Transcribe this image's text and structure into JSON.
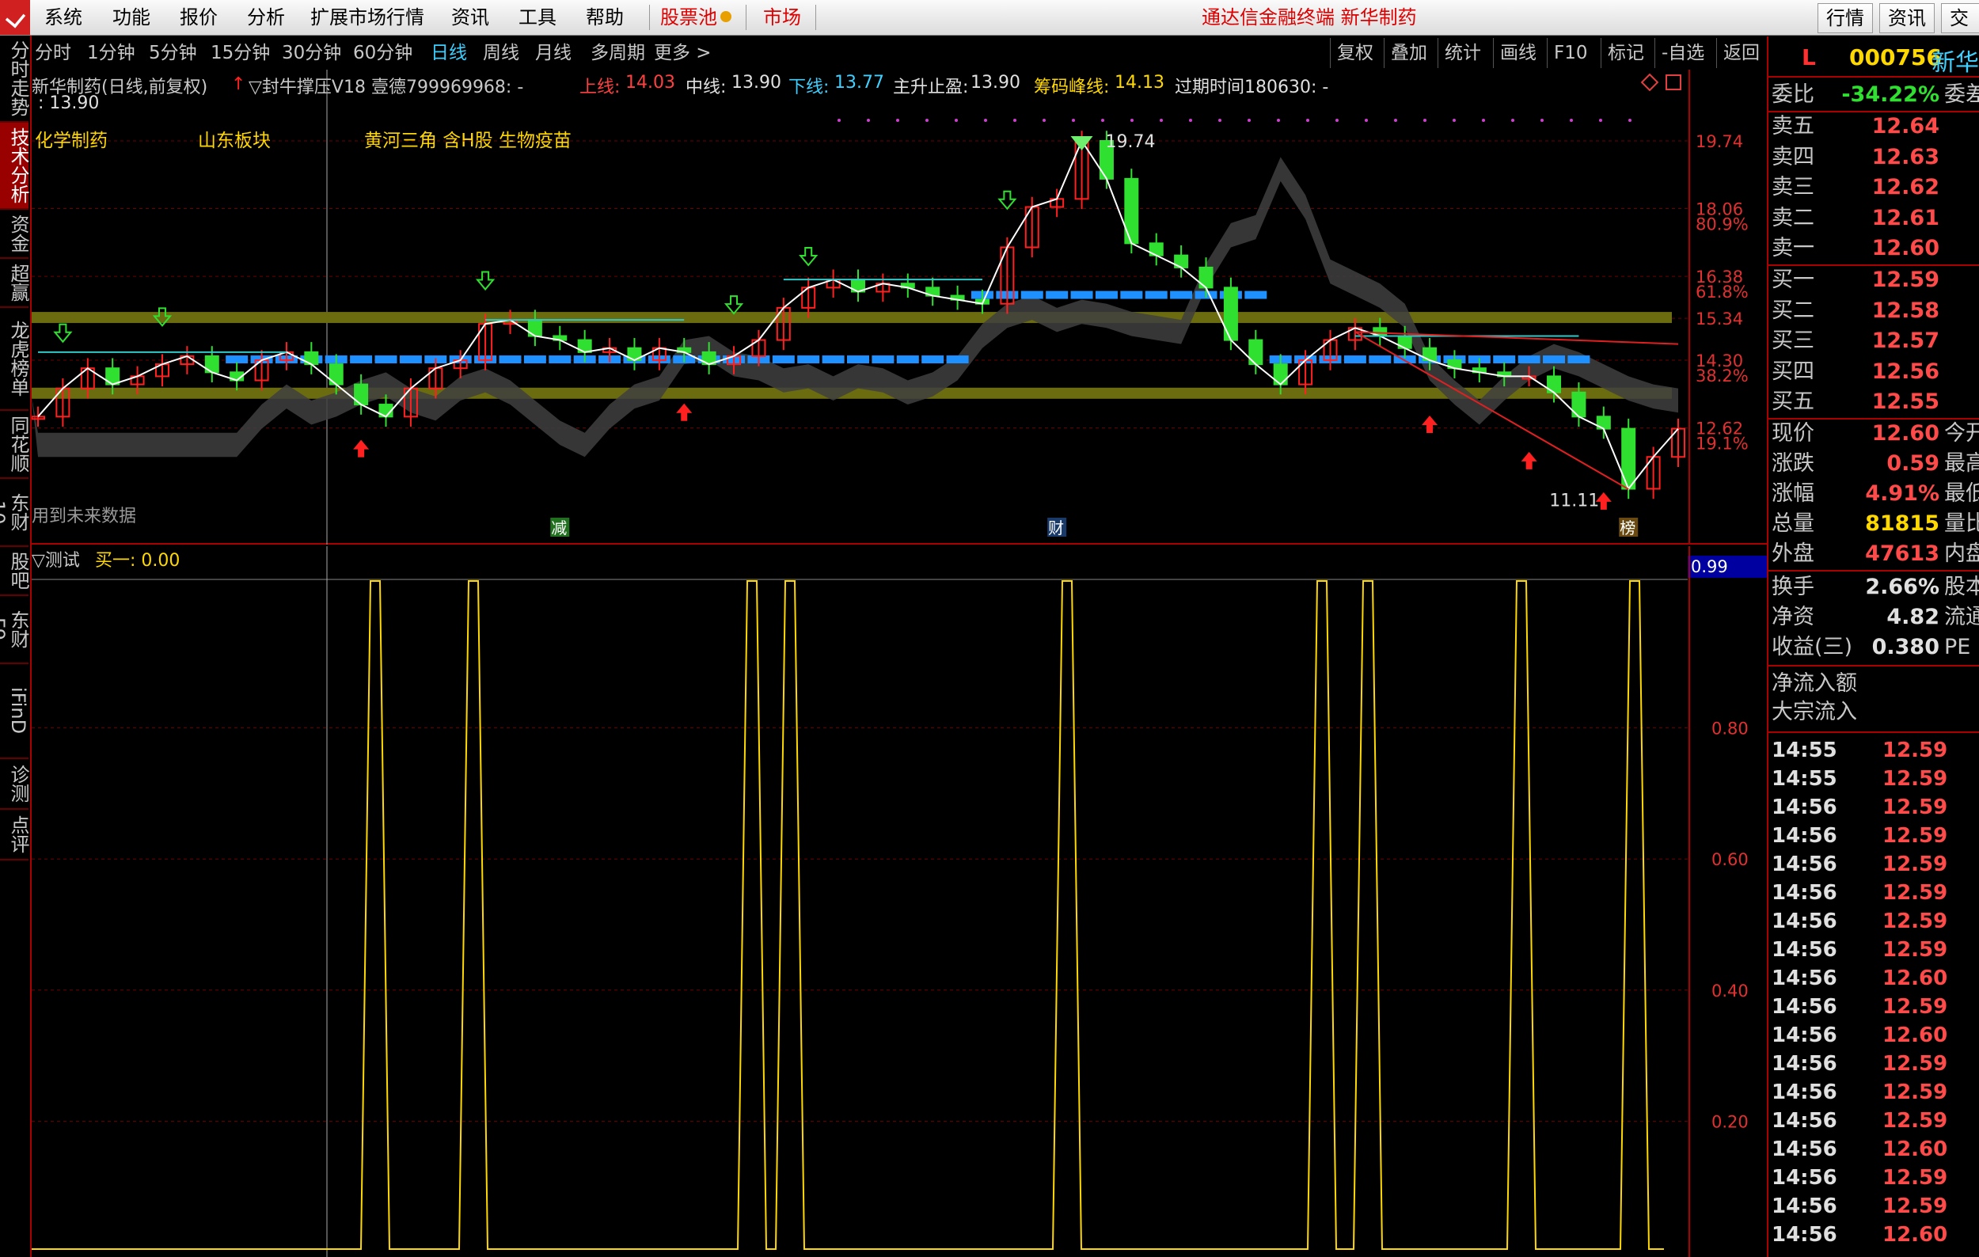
{
  "menubar": {
    "items": [
      "系统",
      "功能",
      "报价",
      "分析",
      "扩展市场行情",
      "资讯",
      "工具",
      "帮助"
    ],
    "stock_pool": "股票池",
    "market": "市场",
    "title": "通达信金融终端  新华制药",
    "right_buttons": [
      "行情",
      "资讯",
      "交易"
    ]
  },
  "lefttabs": [
    "分时走势",
    "技术分析",
    "资金",
    "超赢",
    "龙虎榜单",
    "同花顺",
    "东财10",
    "股吧",
    "东财F9",
    "iFinD",
    "诊测",
    "点评"
  ],
  "periodbar": {
    "periods": [
      "分时",
      "1分钟",
      "5分钟",
      "15分钟",
      "30分钟",
      "60分钟",
      "日线",
      "周线",
      "月线",
      "多周期",
      "更多 >"
    ],
    "active": "日线",
    "tools": [
      "复权",
      "叠加",
      "统计",
      "画线",
      "F10",
      "标记",
      "-自选",
      "返回"
    ]
  },
  "main_chart": {
    "header_name": "新华制药(日线,前复权)",
    "indicator_name": "▽封牛撑压V18 壹德799969968: -",
    "up_label": "上线:",
    "up_val": "14.03",
    "mid_label": "中线:",
    "mid_val": "13.90",
    "down_label": "下线:",
    "down_val": "13.77",
    "stop_label": "主升止盈:",
    "stop_val": "13.90",
    "peak_label": "筹码峰线:",
    "peak_val": "14.13",
    "expire_label": "过期时间180630: -",
    "second_line": ": 13.90",
    "tags": [
      "化学制药",
      "山东板块",
      "黄河三角 含H股 生物疫苗"
    ],
    "future_note": "用到未来数据",
    "high_mark": "19.74",
    "low_mark": "11.11",
    "markers": [
      "减",
      "财",
      "榜"
    ],
    "y_labels": [
      {
        "v": "19.74",
        "pct": ""
      },
      {
        "v": "18.06",
        "pct": "80.9%"
      },
      {
        "v": "16.38",
        "pct": "61.8%"
      },
      {
        "v": "15.34",
        "pct": ""
      },
      {
        "v": "14.30",
        "pct": "38.2%"
      },
      {
        "v": "12.62",
        "pct": "19.1%"
      }
    ]
  },
  "sub_chart": {
    "title": "▽测试",
    "series_label": "买一: 0.00",
    "current": "0.99",
    "y_labels": [
      "0.80",
      "0.60",
      "0.40",
      "0.20"
    ]
  },
  "quote": {
    "code_prefix": "L",
    "code": "000756",
    "name": "新华",
    "weibi_label": "委比",
    "weibi_val": "-34.22%",
    "weibi_extra": "委差",
    "asks": [
      {
        "label": "卖五",
        "price": "12.64"
      },
      {
        "label": "卖四",
        "price": "12.63"
      },
      {
        "label": "卖三",
        "price": "12.62"
      },
      {
        "label": "卖二",
        "price": "12.61"
      },
      {
        "label": "卖一",
        "price": "12.60"
      }
    ],
    "bids": [
      {
        "label": "买一",
        "price": "12.59"
      },
      {
        "label": "买二",
        "price": "12.58"
      },
      {
        "label": "买三",
        "price": "12.57"
      },
      {
        "label": "买四",
        "price": "12.56"
      },
      {
        "label": "买五",
        "price": "12.55"
      }
    ],
    "stats1": [
      {
        "label": "现价",
        "val": "12.60",
        "extra": "今开"
      },
      {
        "label": "涨跌",
        "val": "0.59",
        "extra": "最高"
      },
      {
        "label": "涨幅",
        "val": "4.91%",
        "extra": "最低"
      },
      {
        "label": "总量",
        "val": "81815",
        "extra": "量比"
      },
      {
        "label": "外盘",
        "val": "47613",
        "extra": "内盘"
      }
    ],
    "stats2": [
      {
        "label": "换手",
        "val": "2.66%",
        "extra": "股本"
      },
      {
        "label": "净资",
        "val": "4.82",
        "extra": "流通"
      },
      {
        "label": "收益(三)",
        "val": "0.380",
        "extra": "PE"
      }
    ],
    "flow": [
      "净流入额",
      "大宗流入"
    ],
    "ticks": [
      {
        "t": "14:55",
        "p": "12.59"
      },
      {
        "t": "14:55",
        "p": "12.59"
      },
      {
        "t": "14:56",
        "p": "12.59"
      },
      {
        "t": "14:56",
        "p": "12.59"
      },
      {
        "t": "14:56",
        "p": "12.59"
      },
      {
        "t": "14:56",
        "p": "12.59"
      },
      {
        "t": "14:56",
        "p": "12.59"
      },
      {
        "t": "14:56",
        "p": "12.59"
      },
      {
        "t": "14:56",
        "p": "12.60"
      },
      {
        "t": "14:56",
        "p": "12.59"
      },
      {
        "t": "14:56",
        "p": "12.60"
      },
      {
        "t": "14:56",
        "p": "12.59"
      },
      {
        "t": "14:56",
        "p": "12.59"
      },
      {
        "t": "14:56",
        "p": "12.59"
      },
      {
        "t": "14:56",
        "p": "12.60"
      },
      {
        "t": "14:56",
        "p": "12.59"
      },
      {
        "t": "14:56",
        "p": "12.59"
      },
      {
        "t": "14:56",
        "p": "12.60"
      }
    ]
  },
  "chart_data": {
    "type": "line",
    "title": "新华制药(日线,前复权)",
    "series": [
      {
        "name": "",
        "values": [
          12.9,
          13.6,
          14.1,
          13.7,
          13.9,
          14.2,
          14.4,
          14.0,
          13.8,
          14.3,
          14.5,
          14.2,
          13.7,
          13.2,
          12.9,
          13.6,
          14.1,
          14.3,
          15.2,
          15.3,
          14.9,
          14.8,
          14.5,
          14.6,
          14.3,
          14.6,
          14.5,
          14.2,
          14.4,
          14.8,
          15.6,
          16.1,
          16.3,
          16.0,
          16.2,
          16.1,
          15.9,
          15.8,
          15.7,
          17.1,
          18.1,
          18.3,
          19.74,
          18.8,
          17.2,
          16.9,
          16.6,
          16.1,
          14.8,
          14.2,
          13.7,
          14.3,
          14.8,
          15.1,
          14.9,
          14.6,
          14.3,
          14.1,
          14.0,
          13.9,
          13.9,
          13.5,
          12.9,
          12.6,
          11.11,
          11.9,
          12.6
        ]
      }
    ],
    "ylim": [
      11.1,
      19.74
    ],
    "sub_series": {
      "name": "买一",
      "peaks_at": [
        6,
        8,
        15,
        16,
        21,
        23,
        28,
        30,
        35
      ],
      "max": 1.0
    }
  }
}
